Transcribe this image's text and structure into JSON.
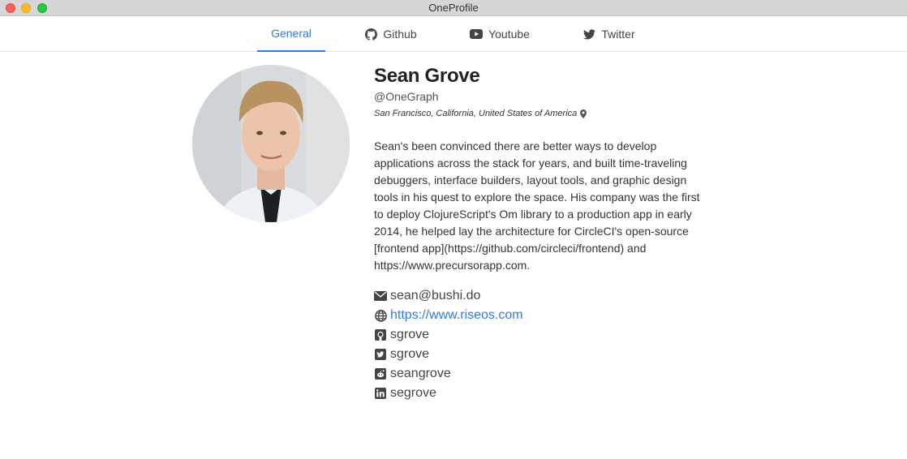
{
  "window": {
    "title": "OneProfile"
  },
  "tabs": [
    {
      "label": "General",
      "icon": "none",
      "active": true
    },
    {
      "label": "Github",
      "icon": "github-icon",
      "active": false
    },
    {
      "label": "Youtube",
      "icon": "youtube-icon",
      "active": false
    },
    {
      "label": "Twitter",
      "icon": "twitter-icon",
      "active": false
    }
  ],
  "profile": {
    "name": "Sean Grove",
    "handle": "@OneGraph",
    "location": "San Francisco, California, United States of America",
    "bio": "Sean's been convinced there are better ways to develop applications across the stack for years, and built time-traveling debuggers, interface builders, layout tools, and graphic design tools in his quest to explore the space. His company was the first to deploy ClojureScript's Om library to a production app in early 2014, he helped lay the architecture for CircleCI's open-source [frontend app](https://github.com/circleci/frontend) and https://www.precursorapp.com."
  },
  "contacts": {
    "email": "sean@bushi.do",
    "website": "https://www.riseos.com",
    "github": "sgrove",
    "twitter": "sgrove",
    "reddit": "seangrove",
    "linkedin": "segrove"
  },
  "colors": {
    "accent": "#2c7be5",
    "titlebar": "#d6d6d6"
  }
}
